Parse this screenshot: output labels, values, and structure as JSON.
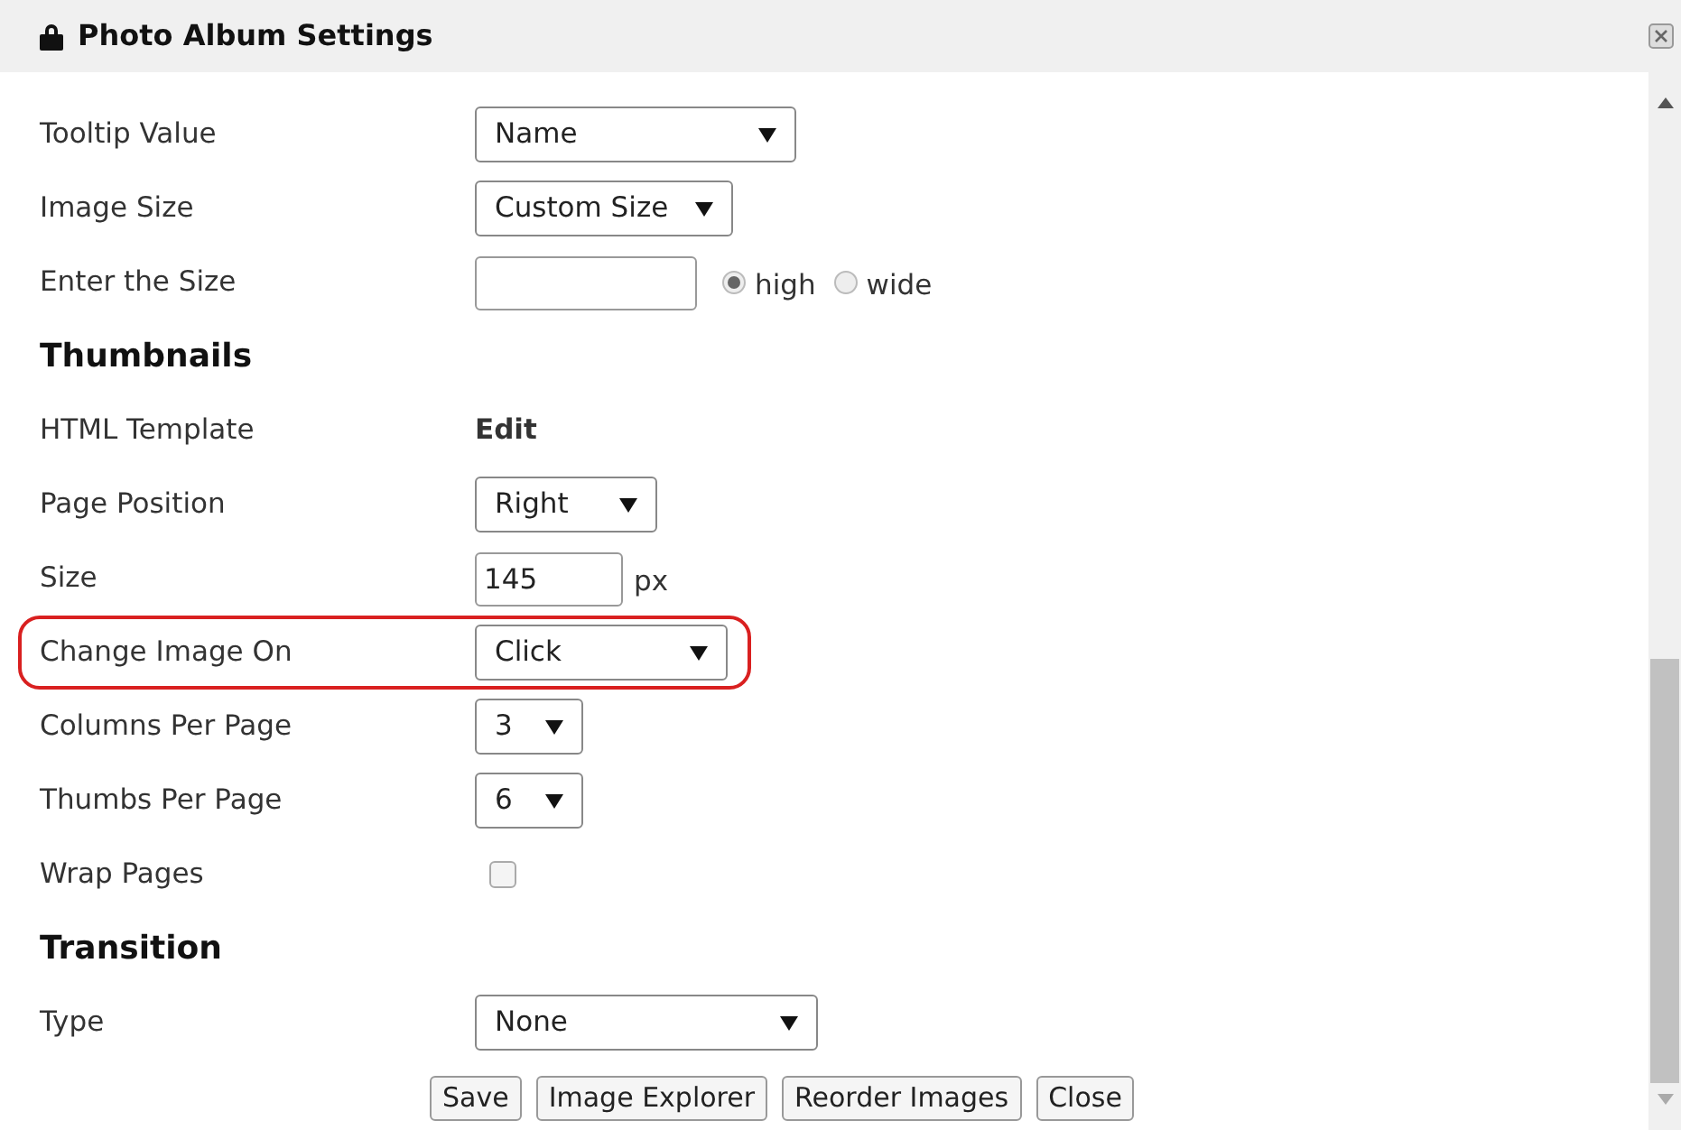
{
  "window": {
    "title": "Photo Album Settings"
  },
  "rows": [
    {
      "kind": "select",
      "label": "Tooltip Value",
      "value": "Name",
      "highlighted": false
    },
    {
      "kind": "select",
      "label": "Image Size",
      "value": "Custom Size",
      "highlighted": false
    },
    {
      "kind": "size",
      "label": "Enter the Size",
      "value": "",
      "options": [
        {
          "label": "high",
          "selected": true
        },
        {
          "label": "wide",
          "selected": false
        }
      ]
    },
    {
      "kind": "heading",
      "label": "Thumbnails"
    },
    {
      "kind": "link",
      "label": "HTML Template",
      "value": "Edit"
    },
    {
      "kind": "select",
      "label": "Page Position",
      "value": "Right",
      "highlighted": false
    },
    {
      "kind": "unit",
      "label": "Size",
      "value": "145",
      "unit": "px"
    },
    {
      "kind": "select",
      "label": "Change Image On",
      "value": "Click",
      "highlighted": true
    },
    {
      "kind": "select",
      "label": "Columns Per Page",
      "value": "3",
      "highlighted": false
    },
    {
      "kind": "select",
      "label": "Thumbs Per Page",
      "value": "6",
      "highlighted": false
    },
    {
      "kind": "checkbox",
      "label": "Wrap Pages",
      "checked": false
    },
    {
      "kind": "heading",
      "label": "Transition"
    },
    {
      "kind": "select",
      "label": "Type",
      "value": "None",
      "highlighted": false
    }
  ],
  "buttons": [
    "Save",
    "Image Explorer",
    "Reorder Images",
    "Close"
  ]
}
